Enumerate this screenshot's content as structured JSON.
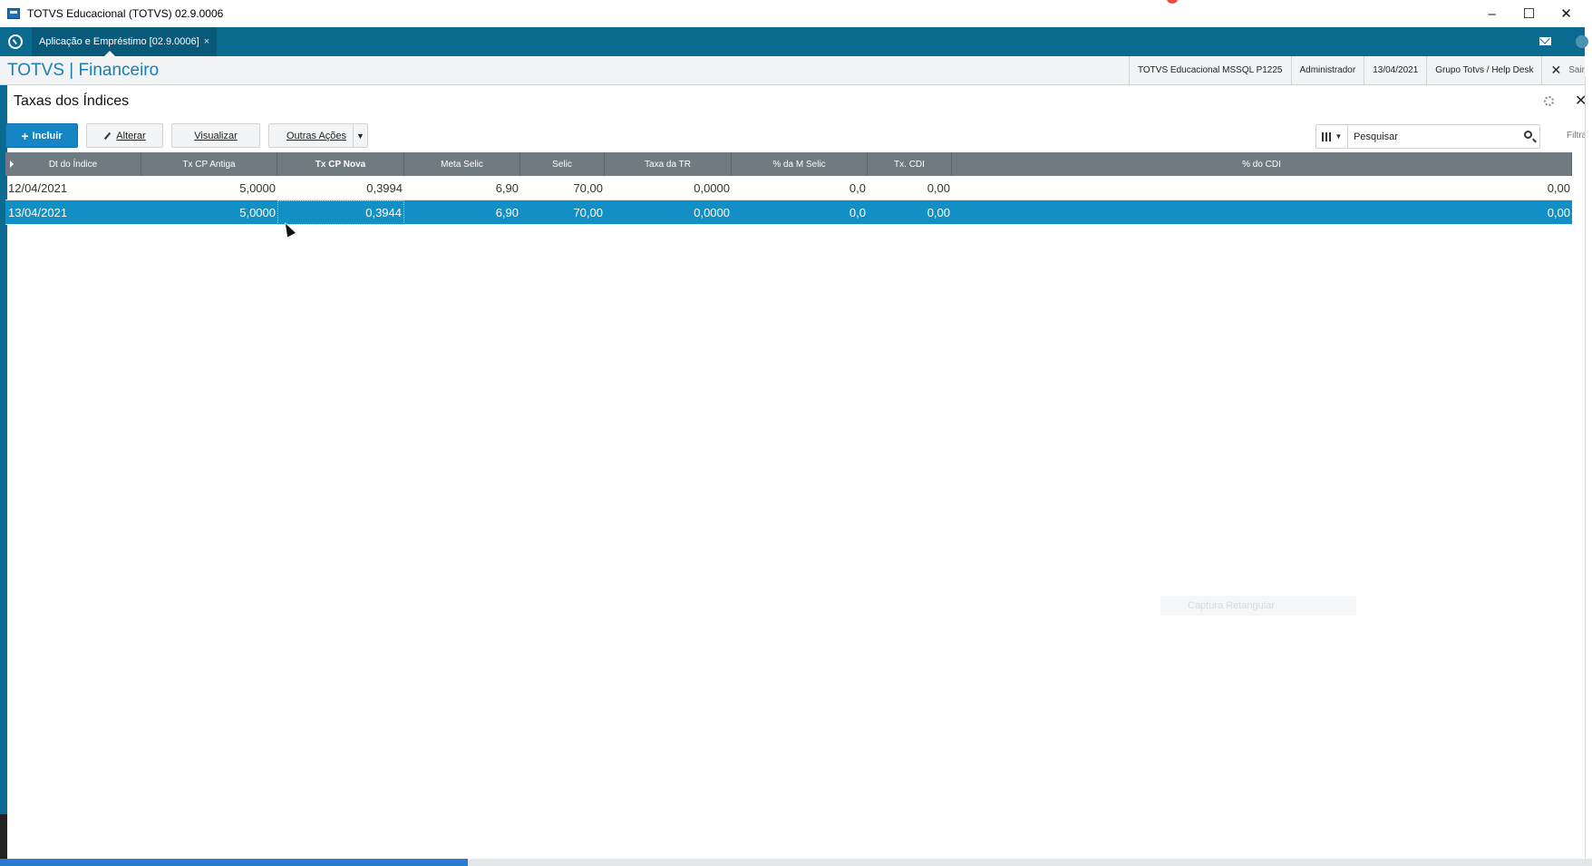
{
  "window": {
    "title": "TOTVS Educacional (TOTVS) 02.9.0006",
    "minimize": "–",
    "maximize": "☐",
    "close": "✕"
  },
  "tabs": [
    {
      "label": "Aplicação e Empréstimo [02.9.0006]",
      "close": "×"
    }
  ],
  "header": {
    "brand": "TOTVS | Financeiro",
    "infos": [
      "TOTVS Educacional MSSQL P1225",
      "Administrador",
      "13/04/2021",
      "Grupo Totvs / Help Desk"
    ],
    "logout_x": "✕",
    "logout_label": "Sair"
  },
  "page": {
    "title": "Taxas dos Índices",
    "close": "✕"
  },
  "toolbar": {
    "incluir": "Incluir",
    "incluir_plus": "+",
    "alterar": "Alterar",
    "visualizar": "Visualizar",
    "outras": "Outras Ações",
    "outras_arrow": "▼"
  },
  "search": {
    "placeholder": "Pesquisar",
    "filtrar": "Filtrar",
    "cols_arrow": "▼"
  },
  "grid": {
    "columns": [
      "Dt do Índice",
      "Tx CP Antiga",
      "Tx CP Nova",
      "Meta Selic",
      "Selic",
      "Taxa da TR",
      "% da M Selic",
      "Tx. CDI",
      "% do CDI"
    ],
    "rows": [
      [
        "12/04/2021",
        "5,0000",
        "0,3994",
        "6,90",
        "70,00",
        "0,0000",
        "0,0",
        "0,00",
        "0,00"
      ],
      [
        "13/04/2021",
        "5,0000",
        "0,3944",
        "6,90",
        "70,00",
        "0,0000",
        "0,0",
        "0,00",
        "0,00"
      ]
    ]
  },
  "ghost_label": "Captura Retangular"
}
